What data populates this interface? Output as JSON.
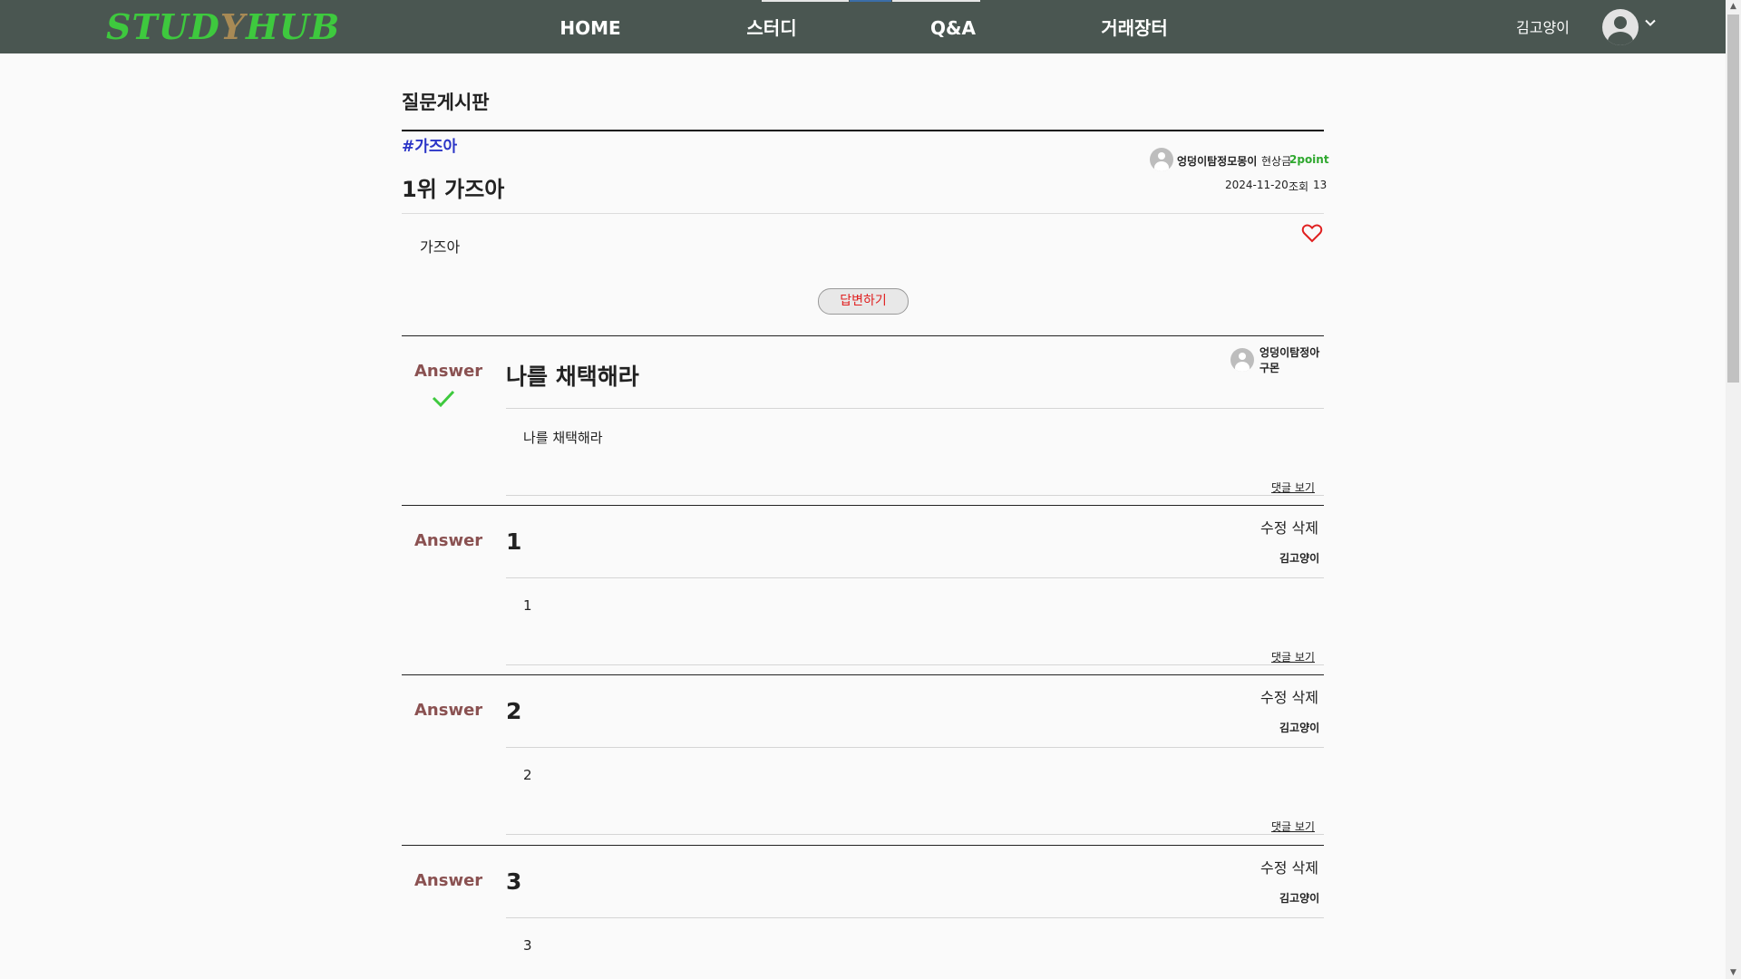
{
  "nav": {
    "logo": {
      "part1": "STUD",
      "part2": "Y",
      "part3": "HUB"
    },
    "links": [
      "HOME",
      "스터디",
      "Q&A",
      "거래장터"
    ],
    "username": "김고양이",
    "avatar_icon": "user-avatar-icon",
    "dropdown_icon": "chevron-down-icon"
  },
  "board": {
    "title": "질문게시판"
  },
  "question": {
    "tag": "#가즈아",
    "title": "1위 가즈아",
    "author": "엉덩이탐정모몽이",
    "bounty_label": "현상금",
    "bounty": "2point",
    "date": "2024-11-20",
    "views_label": "조회",
    "views": "13",
    "body": "가즈아",
    "like_icon": "heart-icon",
    "answer_button": "답변하기"
  },
  "answers": [
    {
      "label": "Answer",
      "accepted": true,
      "title": "나를 채택해라",
      "author": "엉덩이탐정아구몬",
      "body": "나를 채택해라",
      "comments_link": "댓글 보기"
    },
    {
      "label": "Answer",
      "title": "1",
      "edit": "수정",
      "delete": "삭제",
      "author": "김고양이",
      "body": "1",
      "comments_link": "댓글 보기"
    },
    {
      "label": "Answer",
      "title": "2",
      "edit": "수정",
      "delete": "삭제",
      "author": "김고양이",
      "body": "2",
      "comments_link": "댓글 보기"
    },
    {
      "label": "Answer",
      "title": "3",
      "edit": "수정",
      "delete": "삭제",
      "author": "김고양이",
      "body": "3"
    }
  ],
  "colors": {
    "navbar": "#4a5651",
    "logo_green": "#3ec93e",
    "tag_blue": "#2b35c7",
    "bounty_green": "#2fa82f",
    "answer_label": "#8a5151",
    "accent_red": "#e02020"
  }
}
